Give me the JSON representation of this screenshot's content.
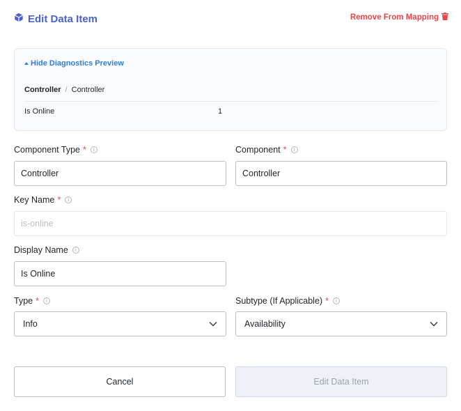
{
  "header": {
    "title": "Edit Data Item",
    "remove_label": "Remove From Mapping"
  },
  "diagnostics": {
    "toggle_label": "Hide Diagnostics Preview",
    "breadcrumb": {
      "first": "Controller",
      "separator": "/",
      "second": "Controller"
    },
    "row": {
      "key": "Is Online",
      "value": "1"
    }
  },
  "form": {
    "component_type": {
      "label": "Component Type",
      "required": "*",
      "value": "Controller"
    },
    "component": {
      "label": "Component",
      "required": "*",
      "value": "Controller"
    },
    "key_name": {
      "label": "Key Name",
      "required": "*",
      "placeholder": "is-online"
    },
    "display_name": {
      "label": "Display Name",
      "value": "Is Online"
    },
    "type": {
      "label": "Type",
      "required": "*",
      "value": "Info"
    },
    "subtype": {
      "label": "Subtype (If Applicable)",
      "required": "*",
      "value": "Availability"
    }
  },
  "actions": {
    "cancel_label": "Cancel",
    "submit_label": "Edit Data Item"
  },
  "icons": {
    "title": "cube-icon",
    "remove": "trash-icon",
    "info": "info-circle-icon",
    "dropdown": "chevron-down-icon"
  },
  "colors": {
    "title": "#4a63c7",
    "remove": "#e5484d",
    "link": "#2f7fd6",
    "required": "#e5484d"
  }
}
